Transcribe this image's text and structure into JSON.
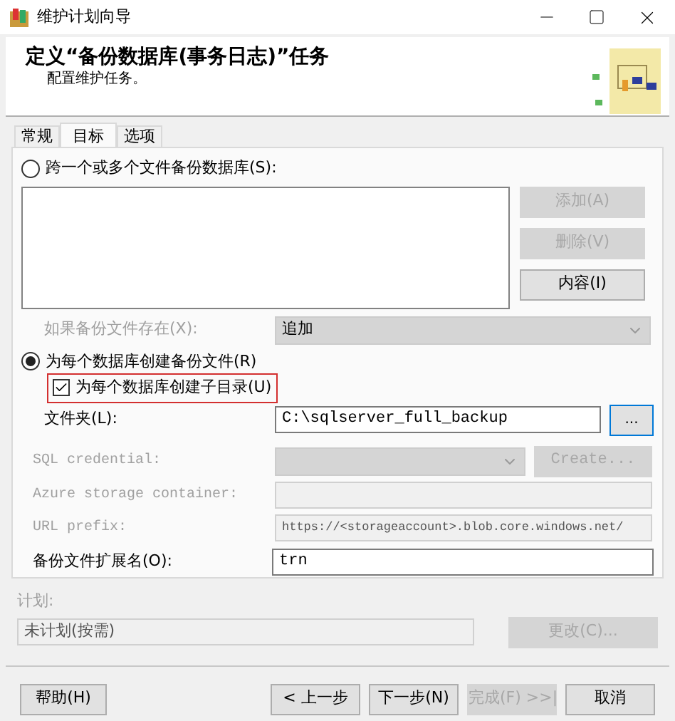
{
  "window": {
    "title": "维护计划向导"
  },
  "header": {
    "title": "定义“备份数据库(事务日志)”任务",
    "subtitle": "配置维护任务。"
  },
  "tabs": [
    {
      "label": "常规",
      "selected": false
    },
    {
      "label": "目标",
      "selected": true
    },
    {
      "label": "选项",
      "selected": false
    }
  ],
  "destination": {
    "across_files": {
      "label": "跨一个或多个文件备份数据库(S):",
      "selected": false
    },
    "side_buttons": [
      {
        "label": "添加(A)",
        "disabled": true
      },
      {
        "label": "删除(V)",
        "disabled": true
      },
      {
        "label": "内容(I)",
        "disabled": false
      }
    ],
    "if_exists": {
      "label": "如果备份文件存在(X):",
      "value": "追加",
      "disabled": true
    },
    "per_database": {
      "label": "为每个数据库创建备份文件(R)",
      "selected": true
    },
    "subdirectory": {
      "label": "为每个数据库创建子目录(U)",
      "checked": true,
      "highlighted": true
    },
    "folder": {
      "label": "文件夹(L):",
      "value": "C:\\sqlserver_full_backup",
      "browse": "..."
    },
    "sql_credential": {
      "label": "SQL credential:",
      "button": "Create...",
      "disabled": true
    },
    "azure_container": {
      "label": "Azure storage container:",
      "disabled": true
    },
    "url_prefix": {
      "label": "URL prefix:",
      "value": "https://<storageaccount>.blob.core.windows.net/",
      "disabled": true
    },
    "extension": {
      "label": "备份文件扩展名(O):",
      "value": "trn"
    }
  },
  "schedule": {
    "label": "计划:",
    "value": "未计划(按需)",
    "button": "更改(C)...",
    "disabled": true
  },
  "buttons": [
    {
      "label": "帮助(H)",
      "disabled": false
    },
    {
      "label": "< 上一步",
      "disabled": false
    },
    {
      "label": "下一步(N)",
      "disabled": false
    },
    {
      "label": "完成(F) >>|",
      "disabled": true
    },
    {
      "label": "取消",
      "disabled": false
    }
  ]
}
